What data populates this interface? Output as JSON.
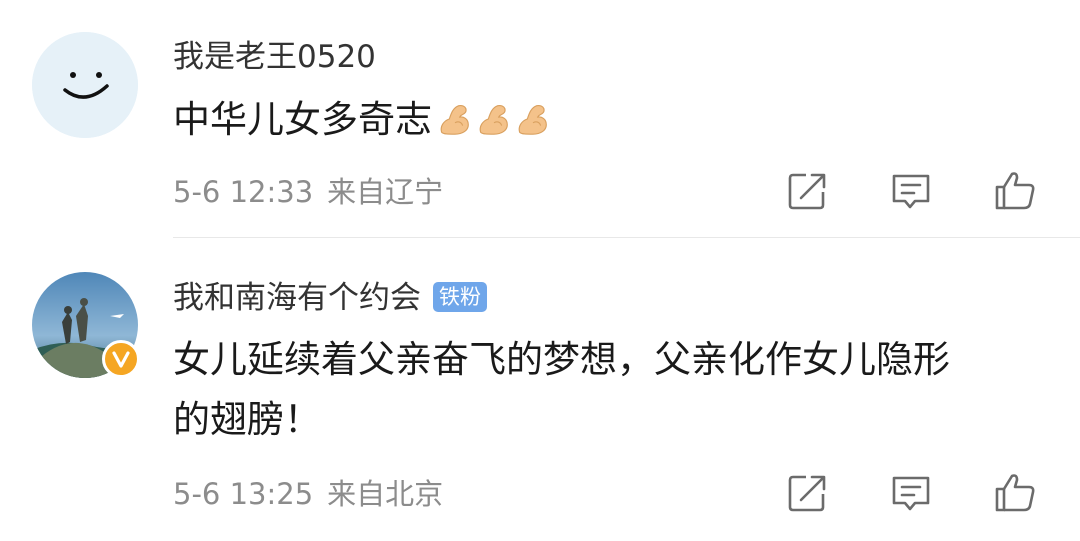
{
  "comments": [
    {
      "username": "我是老王0520",
      "badge": "",
      "text": "中华儿女多奇志",
      "emojis": [
        "flexed-biceps",
        "flexed-biceps",
        "flexed-biceps"
      ],
      "time": "5-6 12:33",
      "location": "来自辽宁"
    },
    {
      "username": "我和南海有个约会",
      "badge": "铁粉",
      "text_line1": "女儿延续着父亲奋飞的梦想，父亲化作女儿隐形",
      "text_line2": "的翅膀！",
      "time": "5-6 13:25",
      "location": "来自北京",
      "verified_icon": "verified-v-icon"
    }
  ],
  "icons": {
    "share": "share-icon",
    "comment": "comment-icon",
    "like": "thumbs-up-icon"
  },
  "colors": {
    "badge_bg": "#6fa6ea",
    "verified": "#f5a623",
    "meta_text": "#8c8c8c",
    "avatar_bg": "#e6f1f8"
  }
}
